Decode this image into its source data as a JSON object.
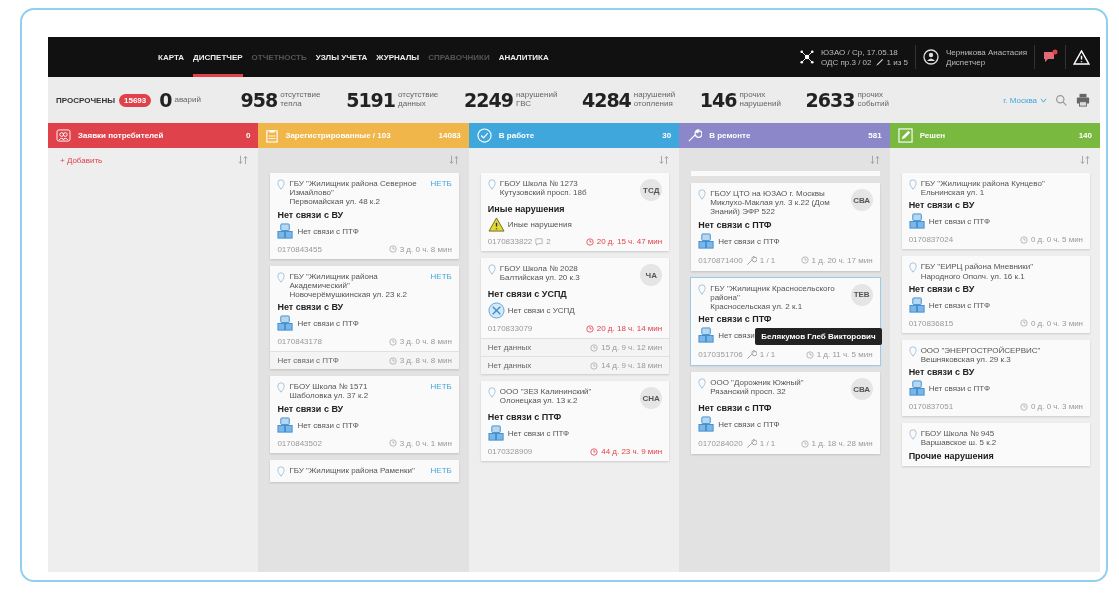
{
  "nav": {
    "items": [
      {
        "label": "КАРТА",
        "selected": false,
        "disabled": false
      },
      {
        "label": "ДИСПЕТЧЕР",
        "selected": true,
        "disabled": false
      },
      {
        "label": "ОТЧЕТНОСТЬ",
        "selected": false,
        "disabled": true
      },
      {
        "label": "УЗЛЫ УЧЕТА",
        "selected": false,
        "disabled": false
      },
      {
        "label": "ЖУРНАЛЫ",
        "selected": false,
        "disabled": false
      },
      {
        "label": "СПРАВОЧНИКИ",
        "selected": false,
        "disabled": true
      },
      {
        "label": "АНАЛИТИКА",
        "selected": false,
        "disabled": false
      }
    ],
    "district": "ЮЗАО / Ср, 17.05.18",
    "shift": "ОДС пр.3 / 02",
    "shift_count": "1 из 5",
    "user_name": "Черникова Анастасия",
    "user_role": "Диспетчер"
  },
  "stats": {
    "overdue_label": "ПРОСРОЧЕНЫ",
    "overdue_count": "15693",
    "items": [
      {
        "value": "0",
        "label": "аварий"
      },
      {
        "value": "958",
        "label": "отсутствие тепла"
      },
      {
        "value": "5191",
        "label": "отсутствие данных"
      },
      {
        "value": "2249",
        "label": "нарушений ГВС"
      },
      {
        "value": "4284",
        "label": "нарушений отопления"
      },
      {
        "value": "146",
        "label": "прочих нарушений"
      },
      {
        "value": "2633",
        "label": "прочих событий"
      }
    ],
    "city": "г. Москва"
  },
  "columns": [
    {
      "title": "Заявки потребителей",
      "count": "0",
      "color": "#e0424b",
      "add_link": "+ Добавить"
    },
    {
      "title": "Зарегистрированные / 103",
      "count": "14083",
      "color": "#f0b64a",
      "cards": [
        {
          "address": [
            "ГБУ \"Жилищник района Северное Измайлово\"",
            "Первомайская ул. 48 к.2"
          ],
          "tag": {
            "kind": "text",
            "text": "НЕТБ"
          },
          "title": "Нет связи с ВУ",
          "kind": "no_link",
          "detail": "Нет связи с ПТФ",
          "number": "0170843455",
          "time": "3 д. 0 ч. 8 мин",
          "overdue": false,
          "selected": false
        },
        {
          "address": [
            "ГБУ \"Жилищник района Академический\"",
            "Новочерёмушкинская ул. 23 к.2"
          ],
          "tag": {
            "kind": "text",
            "text": "НЕТБ"
          },
          "title": "Нет связи с ВУ",
          "kind": "no_link",
          "detail": "Нет связи с ПТФ",
          "number": "0170843178",
          "time": "3 д. 0 ч. 8 мин",
          "overdue": false,
          "rows": [
            {
              "text": "Нет связи с ПТФ",
              "time": "3 д. 8 ч. 8 мин"
            }
          ],
          "selected": false
        },
        {
          "address": [
            "ГБОУ Школа № 1571",
            "Шаболовка ул. 37 к.2"
          ],
          "tag": {
            "kind": "text",
            "text": "НЕТБ"
          },
          "title": "Нет связи с ВУ",
          "kind": "no_link",
          "detail": "Нет связи с ПТФ",
          "number": "0170843502",
          "time": "3 д. 0 ч. 1 мин",
          "overdue": false,
          "selected": false
        },
        {
          "address": [
            "ГБУ \"Жилищник района Раменки\""
          ],
          "tag": {
            "kind": "text",
            "text": "НЕТБ"
          },
          "selected": false
        }
      ]
    },
    {
      "title": "В работе",
      "count": "30",
      "color": "#3fa7dc",
      "cards": [
        {
          "address": [
            "ГБОУ Школа № 1273",
            "Кутузовский просп. 18б"
          ],
          "tag": {
            "kind": "circle",
            "text": "ТСД"
          },
          "title": "Иные нарушения",
          "kind": "warning",
          "detail": "Иные нарушения",
          "number": "0170833822",
          "comment_count": "2",
          "time": "20 д. 15 ч. 47 мин",
          "overdue": true,
          "selected": false
        },
        {
          "address": [
            "ГБОУ Школа № 2028",
            "Балтийская ул. 20 к.3"
          ],
          "tag": {
            "kind": "circle",
            "text": "ЧА"
          },
          "title": "Нет связи с УСПД",
          "kind": "uspd",
          "detail": "Нет связи с УСПД",
          "number": "0170833079",
          "time": "20 д. 18 ч. 14 мин",
          "overdue": true,
          "rows": [
            {
              "text": "Нет данных",
              "time": "15 д. 9 ч. 12 мин"
            },
            {
              "text": "Нет данных",
              "time": "14 д. 9 ч. 18 мин"
            }
          ],
          "selected": false
        },
        {
          "address": [
            "ООО \"ЗЕЗ Калининский\"",
            "Олонецкая ул. 13 к.2"
          ],
          "tag": {
            "kind": "circle",
            "text": "СНА"
          },
          "title": "Нет связи с ПТФ",
          "kind": "no_link",
          "detail": "Нет связи с ПТФ",
          "number": "0170328909",
          "time": "44 д. 23 ч. 9 мин",
          "overdue": true,
          "selected": false
        }
      ]
    },
    {
      "title": "В ремонте",
      "count": "581",
      "color": "#8b87c9",
      "cards": [
        {
          "address": [
            "ГБОУ ЦТО на ЮЗАО г. Москвы",
            "Миклухо-Маклая ул. 3 к.22 (Дом Знаний) ЭФР 522"
          ],
          "tag": {
            "kind": "circle",
            "text": "СВА"
          },
          "title": "Нет связи с ПТФ",
          "kind": "no_link",
          "detail": "Нет связи с ПТФ",
          "number": "0170871400",
          "repair_count": "1 / 1",
          "time": "1 д. 20 ч. 17 мин",
          "overdue": false,
          "selected": false
        },
        {
          "address": [
            "ГБУ \"Жилищник Красносельского района\"",
            "Красносельская ул. 2 к.1"
          ],
          "tag": {
            "kind": "circle",
            "text": "ТЕВ"
          },
          "tooltip": "Белякумов Глеб Викторович",
          "title": "Нет связи с ПТФ",
          "kind": "no_link",
          "detail": "Нет связи",
          "number": "0170351706",
          "repair_count": "1 / 1",
          "time": "1 д. 11 ч. 5 мин",
          "overdue": false,
          "selected": true
        },
        {
          "address": [
            "ООО \"Дорожник Южный\"",
            "Рязанский просп. 32"
          ],
          "tag": {
            "kind": "circle",
            "text": "СВА"
          },
          "title": "Нет связи с ПТФ",
          "kind": "no_link",
          "detail": "Нет связи с ПТФ",
          "number": "0170284020",
          "repair_count": "1 / 1",
          "time": "1 д. 18 ч. 28 мин",
          "overdue": false,
          "selected": false
        }
      ]
    },
    {
      "title": "Решен",
      "count": "140",
      "color": "#79b940",
      "cards": [
        {
          "address": [
            "ГБУ \"Жилищник района Кунцево\"",
            "Ельнинская ул. 1"
          ],
          "title": "Нет связи с ВУ",
          "kind": "no_link",
          "detail": "Нет связи с ПТФ",
          "number": "0170837024",
          "time": "0 д. 0 ч. 5 мин",
          "overdue": false,
          "selected": false
        },
        {
          "address": [
            "ГБУ \"ЕИРЦ района Мневники\"",
            "Народного Ополч. ул. 16 к.1"
          ],
          "title": "Нет связи с ВУ",
          "kind": "no_link",
          "detail": "Нет связи с ПТФ",
          "number": "0170836815",
          "time": "0 д. 0 ч. 3 мин",
          "overdue": false,
          "selected": false
        },
        {
          "address": [
            "ООО \"ЭНЕРГОСТРОЙСЕРВИС\"",
            "Вешняковская ул. 29 к.3"
          ],
          "title": "Нет связи с ВУ",
          "kind": "no_link",
          "detail": "Нет связи с ПТФ",
          "number": "0170837051",
          "time": "0 д. 0 ч. 3 мин",
          "overdue": false,
          "selected": false
        },
        {
          "address": [
            "ГБОУ Школа № 945",
            "Варшавское ш. 5 к.2"
          ],
          "title": "Прочие нарушения",
          "selected": false
        }
      ]
    }
  ]
}
